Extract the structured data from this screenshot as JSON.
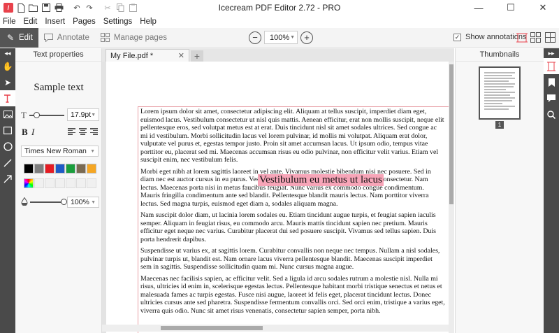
{
  "window": {
    "title": "Icecream PDF Editor 2.72 - PRO",
    "controls": [
      "—",
      "☐",
      "✕"
    ]
  },
  "menu": [
    "File",
    "Edit",
    "Insert",
    "Pages",
    "Settings",
    "Help"
  ],
  "modes": {
    "edit": "Edit",
    "annotate": "Annotate",
    "manage_pages": "Manage pages"
  },
  "zoom": {
    "value": "100%"
  },
  "show_annotations": {
    "label": "Show annotations",
    "checked": true
  },
  "text_properties": {
    "title": "Text properties",
    "sample": "Sample text",
    "font_size": "17.9pt",
    "font_size_slider": 0.2,
    "font": "Times New Roman",
    "colors": [
      "#000000",
      "#7f7f7f",
      "#e51c23",
      "#1e5bc6",
      "#1a9e3c",
      "#7a6a52",
      "#f5a623"
    ],
    "opacity": "100%",
    "opacity_slider": 1.0
  },
  "tabs": [
    {
      "label": "My File.pdf *"
    }
  ],
  "document": {
    "highlight_text": "Vestibulum eu metus ut lacus",
    "paragraphs": [
      "Lorem ipsum dolor sit amet, consectetur adipiscing elit. Aliquam at tellus suscipit, imperdiet diam eget, euismod lacus. Vestibulum consectetur ut nisl quis mattis. Aenean efficitur, erat non mollis suscipit, neque elit pellentesque eros, sed volutpat metus est at erat. Duis tincidunt nisl sit amet sodales ultrices. Sed congue ac mi id vestibulum. Morbi sollicitudin lacus vel lorem pulvinar, id mollis mi volutpat. Aliquam erat dolor, vulputate vel purus et, egestas tempor justo. Proin sit amet accumsan lacus. Ut ipsum odio, tempus vitae porttitor eu, placerat sed mi. Maecenas accumsan risus eu odio pulvinar, non efficitur velit varius. Etiam vel suscipit enim, nec vestibulum felis.",
      "Morbi eget nibh at lorem sagittis laoreet in vel ante. Vivamus molestie bibendum nisi nec posuere. Sed in diam nec est auctor cursus in eu purus. Vestibulum eu metus ut lacus vulputate sagittis consectetur. Nam lectus. Maecenas porta nisi in metus faucibus feugiat. Nunc varius ex commodo congue condimentum. Mauris fringilla condimentum ante sed blandit. Pellentesque blandit mauris lectus. Nam porttitor viverra lectus. Sed magna turpis, euismod eget diam a, sodales aliquam magna.",
      "Nam suscipit dolor diam, ut lacinia lorem sodales eu. Etiam tincidunt augue turpis, et feugiat sapien iaculis semper. Aliquam in feugiat risus, eu commodo arcu. Mauris mattis tincidunt sapien nec pretium. Mauris efficitur eget neque nec varius. Curabitur placerat dui sed posuere suscipit. Vivamus sed tellus sapien. Duis porta hendrerit dapibus.",
      "Suspendisse ut varius ex, at sagittis lorem. Curabitur convallis non neque nec tempus. Nullam a nisl sodales, pulvinar turpis ut, blandit est. Nam ornare lacus viverra pellentesque blandit. Maecenas suscipit imperdiet sem in sagittis. Suspendisse sollicitudin quam mi. Nunc cursus magna augue.",
      "Maecenas nec facilisis sapien, ac efficitur velit. Sed a ligula id arcu sodales rutrum a molestie nisl. Nulla mi risus, ultricies id enim in, scelerisque egestas lectus. Pellentesque habitant morbi tristique senectus et netus et malesuada fames ac turpis egestas. Fusce nisi augue, laoreet id felis eget, placerat tincidunt lectus. Donec ultricies cursus ante sed pharetra. Suspendisse fermentum convallis orci. Sed orci enim, tristique a varius eget, viverra quis odio. Nunc sit amet risus venenatis, consectetur sapien semper, porta nibh."
    ]
  },
  "thumbnails": {
    "title": "Thumbnails",
    "pages": [
      "1"
    ]
  }
}
